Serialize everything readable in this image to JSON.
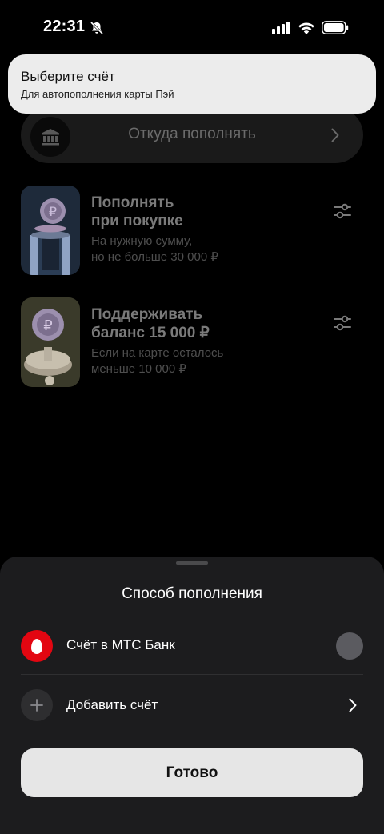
{
  "status_bar": {
    "time": "22:31",
    "icons": [
      "bell-off-icon",
      "signal-icon",
      "wifi-icon",
      "battery-icon"
    ]
  },
  "toast": {
    "title": "Выберите счёт",
    "subtitle": "Для автопополнения карты Пэй"
  },
  "source": {
    "label": "Откуда пополнять",
    "icon": "bank-icon"
  },
  "options": [
    {
      "title_line1": "Пополнять",
      "title_line2": "при покупке",
      "desc_line1": "На нужную сумму,",
      "desc_line2": "но не больше 30 000 ₽",
      "icon": "settings-sliders-icon"
    },
    {
      "title_line1": "Поддерживать",
      "title_line2": "баланс 15 000 ₽",
      "desc_line1": "Если на карте осталось",
      "desc_line2": "меньше 10 000 ₽",
      "icon": "settings-sliders-icon"
    }
  ],
  "sheet": {
    "title": "Способ пополнения",
    "account_label": "Счёт в МТС Банк",
    "add_label": "Добавить счёт",
    "done_label": "Готово"
  },
  "colors": {
    "mts_red": "#e30611",
    "toast_bg": "#ececec",
    "sheet_bg": "#1c1c1e",
    "button_bg": "#e6e6e6"
  }
}
